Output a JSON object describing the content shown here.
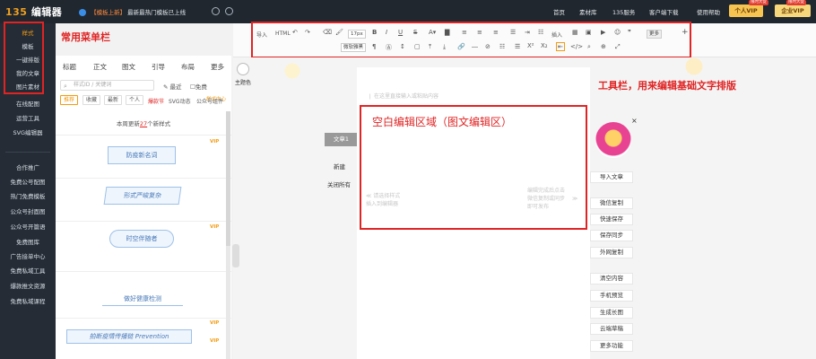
{
  "topbar": {
    "logo_mark": "135",
    "logo_text": "编辑器",
    "notice_tag": "【模板上新】",
    "notice_text": "最新最热门模板已上线",
    "nav": [
      "首页",
      "素材库",
      "135服务",
      "客户端下载",
      "使用帮助"
    ],
    "vip_personal": "个人VIP",
    "vip_enterprise": "企业VIP",
    "vip_badge_personal": "限时大促",
    "vip_badge_enterprise": "限时大促"
  },
  "leftnav": {
    "items_top": [
      "样式",
      "模板",
      "一键排版",
      "我的文章",
      "图片素材",
      "在线配图",
      "运营工具",
      "SVG编辑器"
    ],
    "items_bottom": [
      "合作推广",
      "免费公号配图",
      "热门免费模板",
      "公众号封面图",
      "公众号开篇语",
      "免费图库",
      "广告接单中心",
      "免费私域工具",
      "爆款推文资源",
      "免费私域课程"
    ]
  },
  "annotations": {
    "menu": "常用菜单栏",
    "toolbar": "工具栏，用来编辑基础文字排版",
    "editor": "空白编辑区域（图文编辑区）"
  },
  "stylepanel": {
    "tabs": [
      "标题",
      "正文",
      "图文",
      "引导",
      "布局",
      "更多"
    ],
    "search_placeholder": "样式ID / 关键词",
    "checks": [
      "最近",
      "免费",
      "样式中心"
    ],
    "filters": [
      "推荐",
      "收藏",
      "最新",
      "个人"
    ],
    "filter_links": [
      "爆款节",
      "SVG动态",
      "公众号组件"
    ],
    "update_prefix": "本周更新",
    "update_count": "27",
    "update_suffix": "个新样式",
    "vip": "VIP",
    "samples": [
      "防疫新名词",
      "形式严峻复杂",
      "时空伴随者",
      "做好健康检测",
      "拍断疫情传播链 Prevention"
    ]
  },
  "toolbar": {
    "row1_left": [
      "导入",
      "HTML"
    ],
    "font_size": "17px",
    "insert": "插入",
    "more": "更多",
    "line2_select": "微软雅黑",
    "plus": "+"
  },
  "editor": {
    "placeholder": "在这里直接输入或粘贴内容",
    "hint_left": "请选择样式\n插入到编辑器",
    "hint_right": "编辑完成后点击\n微信复制或同步\n即可发布",
    "side_label": "主题色",
    "left_buttons": [
      "文章1",
      "新建",
      "关闭所有"
    ]
  },
  "actions": [
    "导入文章",
    "微信复制",
    "快速保存",
    "保存同步",
    "外网复制",
    "清空内容",
    "手机预览",
    "生成长图",
    "云端草稿",
    "更多功能"
  ],
  "colors": {
    "accent": "#f39c12",
    "annotation": "#e02424",
    "topbar": "#20272f"
  }
}
